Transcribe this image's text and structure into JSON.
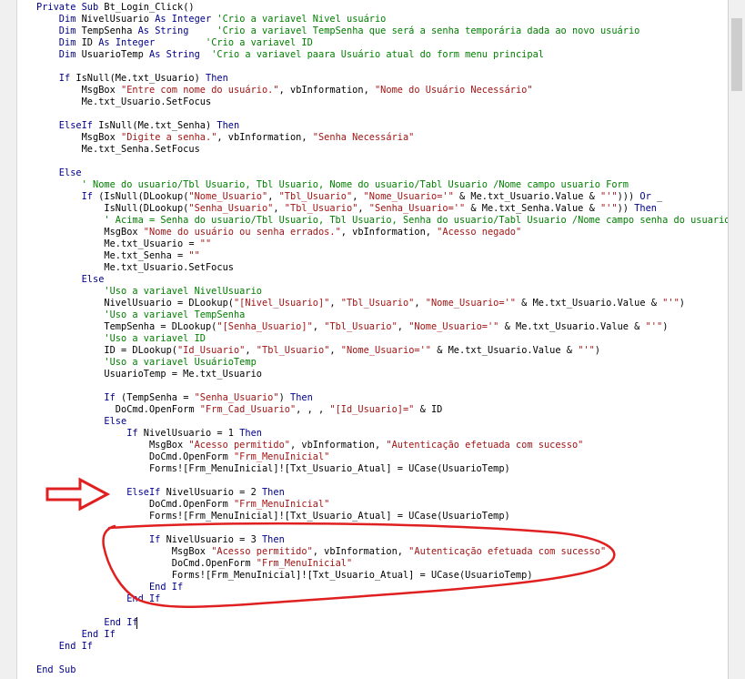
{
  "editor": {
    "lines": [
      {
        "id": 0,
        "segments": [
          {
            "t": "Private Sub ",
            "c": "kw"
          },
          {
            "t": "Bt_Login_Click()",
            "c": "tx"
          }
        ]
      },
      {
        "id": 1,
        "segments": [
          {
            "t": "    Dim ",
            "c": "kw"
          },
          {
            "t": "NivelUsuario ",
            "c": "tx"
          },
          {
            "t": "As Integer ",
            "c": "kw"
          },
          {
            "t": "'Crio a variavel Nivel usuário",
            "c": "cm"
          }
        ]
      },
      {
        "id": 2,
        "segments": [
          {
            "t": "    Dim ",
            "c": "kw"
          },
          {
            "t": "TempSenha ",
            "c": "tx"
          },
          {
            "t": "As String     ",
            "c": "kw"
          },
          {
            "t": "'Crio a variavel TempSenha que será a senha temporária dada ao novo usuário",
            "c": "cm"
          }
        ]
      },
      {
        "id": 3,
        "segments": [
          {
            "t": "    Dim ",
            "c": "kw"
          },
          {
            "t": "ID ",
            "c": "tx"
          },
          {
            "t": "As Integer         ",
            "c": "kw"
          },
          {
            "t": "'Crio a variavel ID",
            "c": "cm"
          }
        ]
      },
      {
        "id": 4,
        "segments": [
          {
            "t": "    Dim ",
            "c": "kw"
          },
          {
            "t": "UsuarioTemp ",
            "c": "tx"
          },
          {
            "t": "As String  ",
            "c": "kw"
          },
          {
            "t": "'Crio a variavel paara Usuário atual do form menu principal",
            "c": "cm"
          }
        ]
      },
      {
        "id": 6,
        "segments": [
          {
            "t": "    If ",
            "c": "kw"
          },
          {
            "t": "IsNull(Me.txt_Usuario) ",
            "c": "tx"
          },
          {
            "t": "Then",
            "c": "kw"
          }
        ]
      },
      {
        "id": 7,
        "segments": [
          {
            "t": "        MsgBox ",
            "c": "tx"
          },
          {
            "t": "\"Entre com nome do usuário.\"",
            "c": "str"
          },
          {
            "t": ", vbInformation, ",
            "c": "tx"
          },
          {
            "t": "\"Nome do Usuário Necessário\"",
            "c": "str"
          }
        ]
      },
      {
        "id": 8,
        "segments": [
          {
            "t": "        Me.txt_Usuario.SetFocus",
            "c": "tx"
          }
        ]
      },
      {
        "id": 10,
        "segments": [
          {
            "t": "    ElseIf ",
            "c": "kw"
          },
          {
            "t": "IsNull(Me.txt_Senha) ",
            "c": "tx"
          },
          {
            "t": "Then",
            "c": "kw"
          }
        ]
      },
      {
        "id": 11,
        "segments": [
          {
            "t": "        MsgBox ",
            "c": "tx"
          },
          {
            "t": "\"Digite a senha.\"",
            "c": "str"
          },
          {
            "t": ", vbInformation, ",
            "c": "tx"
          },
          {
            "t": "\"Senha Necessária\"",
            "c": "str"
          }
        ]
      },
      {
        "id": 12,
        "segments": [
          {
            "t": "        Me.txt_Senha.SetFocus",
            "c": "tx"
          }
        ]
      },
      {
        "id": 14,
        "segments": [
          {
            "t": "    Else",
            "c": "kw"
          }
        ]
      },
      {
        "id": 15,
        "segments": [
          {
            "t": "        ' Nome do usuario/Tbl Usuario, Tbl Usuario, Nome do usuario/Tabl Usuario /Nome campo usuario Form",
            "c": "cm"
          }
        ]
      },
      {
        "id": 16,
        "segments": [
          {
            "t": "        If ",
            "c": "kw"
          },
          {
            "t": "(IsNull(DLookup(",
            "c": "tx"
          },
          {
            "t": "\"Nome_Usuario\"",
            "c": "str"
          },
          {
            "t": ", ",
            "c": "tx"
          },
          {
            "t": "\"Tbl_Usuario\"",
            "c": "str"
          },
          {
            "t": ", ",
            "c": "tx"
          },
          {
            "t": "\"Nome_Usuario='\"",
            "c": "str"
          },
          {
            "t": " & Me.txt_Usuario.Value & ",
            "c": "tx"
          },
          {
            "t": "\"'\"",
            "c": "str"
          },
          {
            "t": "))) ",
            "c": "tx"
          },
          {
            "t": "Or",
            "c": "kw"
          },
          {
            "t": " _",
            "c": "tx"
          }
        ]
      },
      {
        "id": 17,
        "segments": [
          {
            "t": "            IsNull(DLookup(",
            "c": "tx"
          },
          {
            "t": "\"Senha_Usuario\"",
            "c": "str"
          },
          {
            "t": ", ",
            "c": "tx"
          },
          {
            "t": "\"Tbl_Usuario\"",
            "c": "str"
          },
          {
            "t": ", ",
            "c": "tx"
          },
          {
            "t": "\"Senha_Usuario='\"",
            "c": "str"
          },
          {
            "t": " & Me.txt_Senha.Value & ",
            "c": "tx"
          },
          {
            "t": "\"'\"",
            "c": "str"
          },
          {
            "t": ")) ",
            "c": "tx"
          },
          {
            "t": "Then",
            "c": "kw"
          }
        ]
      },
      {
        "id": 18,
        "segments": [
          {
            "t": "            ' Acima = Senha do usuario/Tbl Usuario, Tbl Usuario, Senha do usuario/Tabl Usuario /Nome campo senha do usuario Form",
            "c": "cm"
          }
        ]
      },
      {
        "id": 19,
        "segments": [
          {
            "t": "            MsgBox ",
            "c": "tx"
          },
          {
            "t": "\"Nome do usuário ou senha errados.\"",
            "c": "str"
          },
          {
            "t": ", vbInformation, ",
            "c": "tx"
          },
          {
            "t": "\"Acesso negado\"",
            "c": "str"
          }
        ]
      },
      {
        "id": 20,
        "segments": [
          {
            "t": "            Me.txt_Usuario = ",
            "c": "tx"
          },
          {
            "t": "\"\"",
            "c": "str"
          }
        ]
      },
      {
        "id": 21,
        "segments": [
          {
            "t": "            Me.txt_Senha = ",
            "c": "tx"
          },
          {
            "t": "\"\"",
            "c": "str"
          }
        ]
      },
      {
        "id": 22,
        "segments": [
          {
            "t": "            Me.txt_Usuario.SetFocus",
            "c": "tx"
          }
        ]
      },
      {
        "id": 23,
        "segments": [
          {
            "t": "        Else",
            "c": "kw"
          }
        ]
      },
      {
        "id": 24,
        "segments": [
          {
            "t": "            'Uso a variavel NivelUsuario",
            "c": "cm"
          }
        ]
      },
      {
        "id": 25,
        "segments": [
          {
            "t": "            NivelUsuario = DLookup(",
            "c": "tx"
          },
          {
            "t": "\"[Nivel_Usuario]\"",
            "c": "str"
          },
          {
            "t": ", ",
            "c": "tx"
          },
          {
            "t": "\"Tbl_Usuario\"",
            "c": "str"
          },
          {
            "t": ", ",
            "c": "tx"
          },
          {
            "t": "\"Nome_Usuario='\"",
            "c": "str"
          },
          {
            "t": " & Me.txt_Usuario.Value & ",
            "c": "tx"
          },
          {
            "t": "\"'\"",
            "c": "str"
          },
          {
            "t": ")",
            "c": "tx"
          }
        ]
      },
      {
        "id": 26,
        "segments": [
          {
            "t": "            'Uso a variavel TempSenha",
            "c": "cm"
          }
        ]
      },
      {
        "id": 27,
        "segments": [
          {
            "t": "            TempSenha = DLookup(",
            "c": "tx"
          },
          {
            "t": "\"[Senha_Usuario]\"",
            "c": "str"
          },
          {
            "t": ", ",
            "c": "tx"
          },
          {
            "t": "\"Tbl_Usuario\"",
            "c": "str"
          },
          {
            "t": ", ",
            "c": "tx"
          },
          {
            "t": "\"Nome_Usuario='\"",
            "c": "str"
          },
          {
            "t": " & Me.txt_Usuario.Value & ",
            "c": "tx"
          },
          {
            "t": "\"'\"",
            "c": "str"
          },
          {
            "t": ")",
            "c": "tx"
          }
        ]
      },
      {
        "id": 28,
        "segments": [
          {
            "t": "            'Uso a variavel ID",
            "c": "cm"
          }
        ]
      },
      {
        "id": 29,
        "segments": [
          {
            "t": "            ID = DLookup(",
            "c": "tx"
          },
          {
            "t": "\"Id_Usuario\"",
            "c": "str"
          },
          {
            "t": ", ",
            "c": "tx"
          },
          {
            "t": "\"Tbl_Usuario\"",
            "c": "str"
          },
          {
            "t": ", ",
            "c": "tx"
          },
          {
            "t": "\"Nome_Usuario='\"",
            "c": "str"
          },
          {
            "t": " & Me.txt_Usuario.Value & ",
            "c": "tx"
          },
          {
            "t": "\"'\"",
            "c": "str"
          },
          {
            "t": ")",
            "c": "tx"
          }
        ]
      },
      {
        "id": 30,
        "segments": [
          {
            "t": "            'Uso a variavel UsuárioTemp",
            "c": "cm"
          }
        ]
      },
      {
        "id": 31,
        "segments": [
          {
            "t": "            UsuarioTemp = Me.txt_Usuario",
            "c": "tx"
          }
        ]
      },
      {
        "id": 33,
        "segments": [
          {
            "t": "            If ",
            "c": "kw"
          },
          {
            "t": "(TempSenha = ",
            "c": "tx"
          },
          {
            "t": "\"Senha_Usuario\"",
            "c": "str"
          },
          {
            "t": ") ",
            "c": "tx"
          },
          {
            "t": "Then",
            "c": "kw"
          }
        ]
      },
      {
        "id": 34,
        "segments": [
          {
            "t": "              DoCmd.OpenForm ",
            "c": "tx"
          },
          {
            "t": "\"Frm_Cad_Usuario\"",
            "c": "str"
          },
          {
            "t": ", , , ",
            "c": "tx"
          },
          {
            "t": "\"[Id_Usuario]=\"",
            "c": "str"
          },
          {
            "t": " & ID",
            "c": "tx"
          }
        ]
      },
      {
        "id": 35,
        "segments": [
          {
            "t": "            Else",
            "c": "kw"
          }
        ]
      },
      {
        "id": 36,
        "segments": [
          {
            "t": "                If ",
            "c": "kw"
          },
          {
            "t": "NivelUsuario = 1 ",
            "c": "tx"
          },
          {
            "t": "Then",
            "c": "kw"
          }
        ]
      },
      {
        "id": 37,
        "segments": [
          {
            "t": "                    MsgBox ",
            "c": "tx"
          },
          {
            "t": "\"Acesso permitido\"",
            "c": "str"
          },
          {
            "t": ", vbInformation, ",
            "c": "tx"
          },
          {
            "t": "\"Autenticação efetuada com sucesso\"",
            "c": "str"
          }
        ]
      },
      {
        "id": 38,
        "segments": [
          {
            "t": "                    DoCmd.OpenForm ",
            "c": "tx"
          },
          {
            "t": "\"Frm_MenuInicial\"",
            "c": "str"
          }
        ]
      },
      {
        "id": 39,
        "segments": [
          {
            "t": "                    Forms![Frm_MenuInicial]![Txt_Usuario_Atual] = UCase(UsuarioTemp)",
            "c": "tx"
          }
        ]
      },
      {
        "id": 41,
        "segments": [
          {
            "t": "                ElseIf ",
            "c": "kw"
          },
          {
            "t": "NivelUsuario = 2 ",
            "c": "tx"
          },
          {
            "t": "Then",
            "c": "kw"
          }
        ]
      },
      {
        "id": 42,
        "segments": [
          {
            "t": "                    DoCmd.OpenForm ",
            "c": "tx"
          },
          {
            "t": "\"Frm_MenuInicial\"",
            "c": "str"
          }
        ]
      },
      {
        "id": 43,
        "segments": [
          {
            "t": "                    Forms![Frm_MenuInicial]![Txt_Usuario_Atual] = UCase(UsuarioTemp)",
            "c": "tx"
          }
        ]
      },
      {
        "id": 45,
        "segments": [
          {
            "t": "                    If ",
            "c": "kw"
          },
          {
            "t": "NivelUsuario = 3 ",
            "c": "tx"
          },
          {
            "t": "Then",
            "c": "kw"
          }
        ]
      },
      {
        "id": 46,
        "segments": [
          {
            "t": "                        MsgBox ",
            "c": "tx"
          },
          {
            "t": "\"Acesso permitido\"",
            "c": "str"
          },
          {
            "t": ", vbInformation, ",
            "c": "tx"
          },
          {
            "t": "\"Autenticação efetuada com sucesso\"",
            "c": "str"
          }
        ]
      },
      {
        "id": 47,
        "segments": [
          {
            "t": "                        DoCmd.OpenForm ",
            "c": "tx"
          },
          {
            "t": "\"Frm_MenuInicial\"",
            "c": "str"
          }
        ]
      },
      {
        "id": 48,
        "segments": [
          {
            "t": "                        Forms![Frm_MenuInicial]![Txt_Usuario_Atual] = UCase(UsuarioTemp)",
            "c": "tx"
          }
        ]
      },
      {
        "id": 49,
        "segments": [
          {
            "t": "                    End If",
            "c": "kw"
          }
        ]
      },
      {
        "id": 50,
        "segments": [
          {
            "t": "                End If",
            "c": "kw"
          }
        ]
      },
      {
        "id": 52,
        "segments": [
          {
            "t": "            End If",
            "c": "kw"
          }
        ]
      },
      {
        "id": 53,
        "segments": [
          {
            "t": "        End If",
            "c": "kw"
          }
        ]
      },
      {
        "id": 54,
        "segments": [
          {
            "t": "    End If",
            "c": "kw"
          }
        ]
      },
      {
        "id": 56,
        "segments": [
          {
            "t": "End Sub",
            "c": "kw"
          }
        ]
      }
    ]
  },
  "colors": {
    "keyword": "#00008b",
    "string": "#a31515",
    "comment": "#008000",
    "annotation": "#e02020"
  }
}
